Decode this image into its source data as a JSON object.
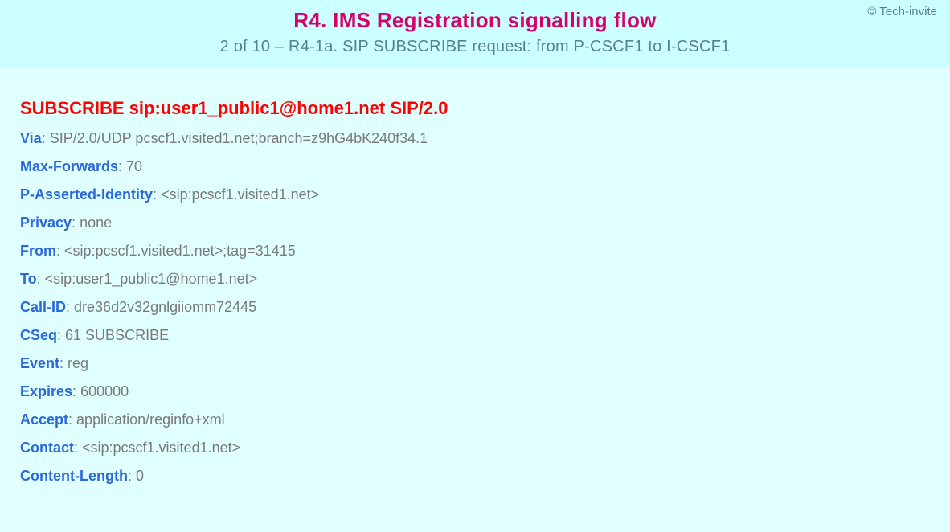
{
  "copyright": "© Tech-invite",
  "title": "R4. IMS Registration signalling flow",
  "subtitle": "2 of 10 – R4-1a. SIP SUBSCRIBE request: from P-CSCF1 to I-CSCF1",
  "request_line": "SUBSCRIBE sip:user1_public1@home1.net SIP/2.0",
  "headers": [
    {
      "name": "Via",
      "value": "SIP/2.0/UDP pcscf1.visited1.net;branch=z9hG4bK240f34.1"
    },
    {
      "name": "Max-Forwards",
      "value": "70"
    },
    {
      "name": "P-Asserted-Identity",
      "value": "<sip:pcscf1.visited1.net>"
    },
    {
      "name": "Privacy",
      "value": "none"
    },
    {
      "name": "From",
      "value": "<sip:pcscf1.visited1.net>;tag=31415"
    },
    {
      "name": "To",
      "value": "<sip:user1_public1@home1.net>"
    },
    {
      "name": "Call-ID",
      "value": "dre36d2v32gnlgiiomm72445"
    },
    {
      "name": "CSeq",
      "value": "61 SUBSCRIBE"
    },
    {
      "name": "Event",
      "value": "reg"
    },
    {
      "name": "Expires",
      "value": "600000"
    },
    {
      "name": "Accept",
      "value": "application/reginfo+xml"
    },
    {
      "name": "Contact",
      "value": "<sip:pcscf1.visited1.net>"
    },
    {
      "name": "Content-Length",
      "value": "0"
    }
  ]
}
